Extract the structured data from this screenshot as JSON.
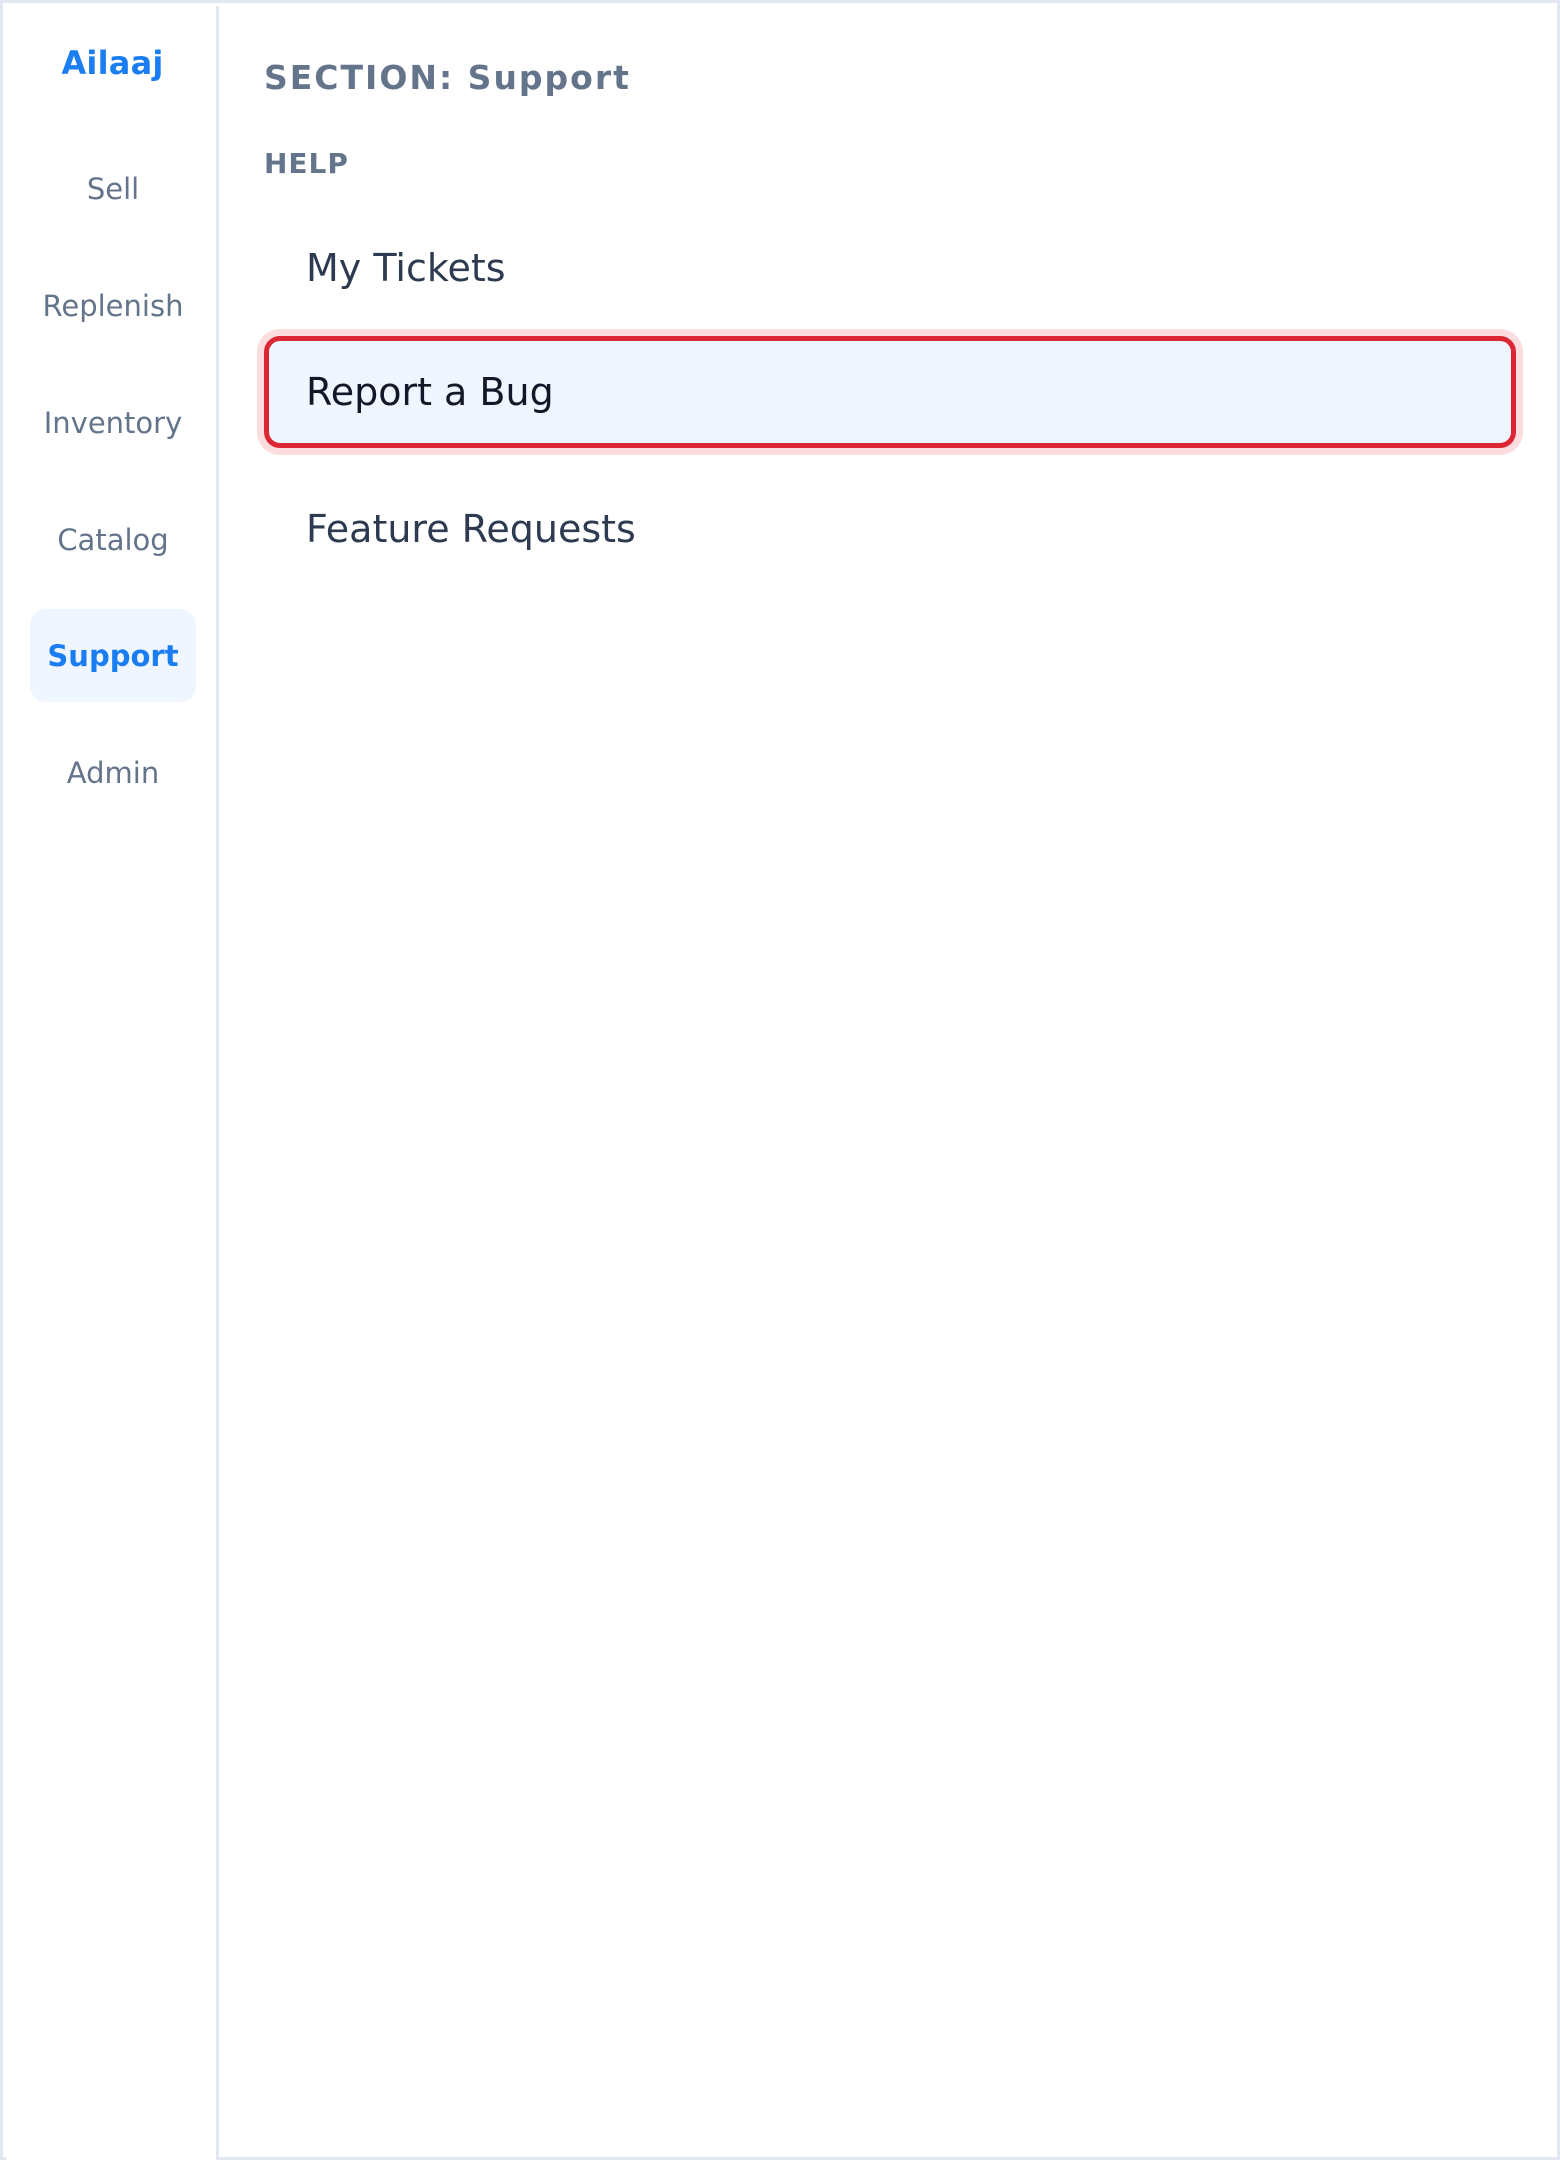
{
  "brand": "Ailaaj",
  "sidebar": {
    "items": [
      {
        "label": "Sell",
        "active": false
      },
      {
        "label": "Replenish",
        "active": false
      },
      {
        "label": "Inventory",
        "active": false
      },
      {
        "label": "Catalog",
        "active": false
      },
      {
        "label": "Support",
        "active": true
      },
      {
        "label": "Admin",
        "active": false
      }
    ]
  },
  "main": {
    "section_title": "SECTION: Support",
    "group_label": "HELP",
    "menu": [
      {
        "label": "My Tickets",
        "selected": false
      },
      {
        "label": "Report a Bug",
        "selected": true
      },
      {
        "label": "Feature Requests",
        "selected": false
      }
    ]
  },
  "colors": {
    "accent": "#1a7ef2",
    "highlight_border": "#dc2633",
    "active_bg": "#eff6ff"
  }
}
